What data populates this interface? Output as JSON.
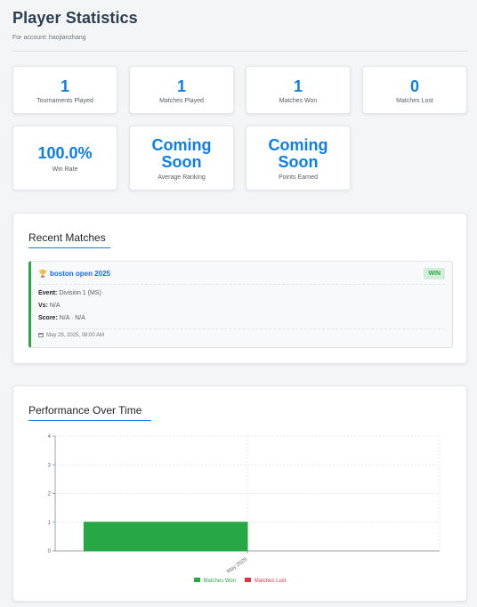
{
  "header": {
    "title": "Player Statistics",
    "subtitle": "For account: haojianzhang"
  },
  "stats": [
    {
      "value": "1",
      "label": "Tournaments Played"
    },
    {
      "value": "1",
      "label": "Matches Played"
    },
    {
      "value": "1",
      "label": "Matches Won"
    },
    {
      "value": "0",
      "label": "Matches Lost"
    },
    {
      "value": "100.0%",
      "label": "Win Rate"
    },
    {
      "value_line1": "Coming",
      "value_line2": "Soon",
      "label": "Average Ranking"
    },
    {
      "value_line1": "Coming",
      "value_line2": "Soon",
      "label": "Points Earned"
    }
  ],
  "recent_matches": {
    "title": "Recent Matches",
    "items": [
      {
        "tournament": "boston open 2025",
        "result": "WIN",
        "event_label": "Event:",
        "event_value": "Division 1 (MS)",
        "vs_label": "Vs:",
        "vs_value": "N/A",
        "score_label": "Score:",
        "score_value": "N/A · N/A",
        "datetime": "May 29, 2025, 08:00 AM"
      }
    ]
  },
  "performance": {
    "title": "Performance Over Time"
  },
  "chart_data": {
    "type": "bar",
    "categories": [
      "May 2025"
    ],
    "series": [
      {
        "name": "Matches Won",
        "values": [
          1
        ],
        "color": "#28a745"
      },
      {
        "name": "Matches Lost",
        "values": [
          0
        ],
        "color": "#dc3545"
      }
    ],
    "yticks": [
      "0",
      "1",
      "2",
      "3",
      "4"
    ],
    "ylim": [
      0,
      4
    ],
    "grid": true,
    "legend": "bottom"
  },
  "colors": {
    "accent": "#0d7ee6",
    "win": "#28a745",
    "loss": "#dc3545"
  },
  "icons": {
    "tournament": "trophy-icon",
    "date": "calendar-icon"
  }
}
